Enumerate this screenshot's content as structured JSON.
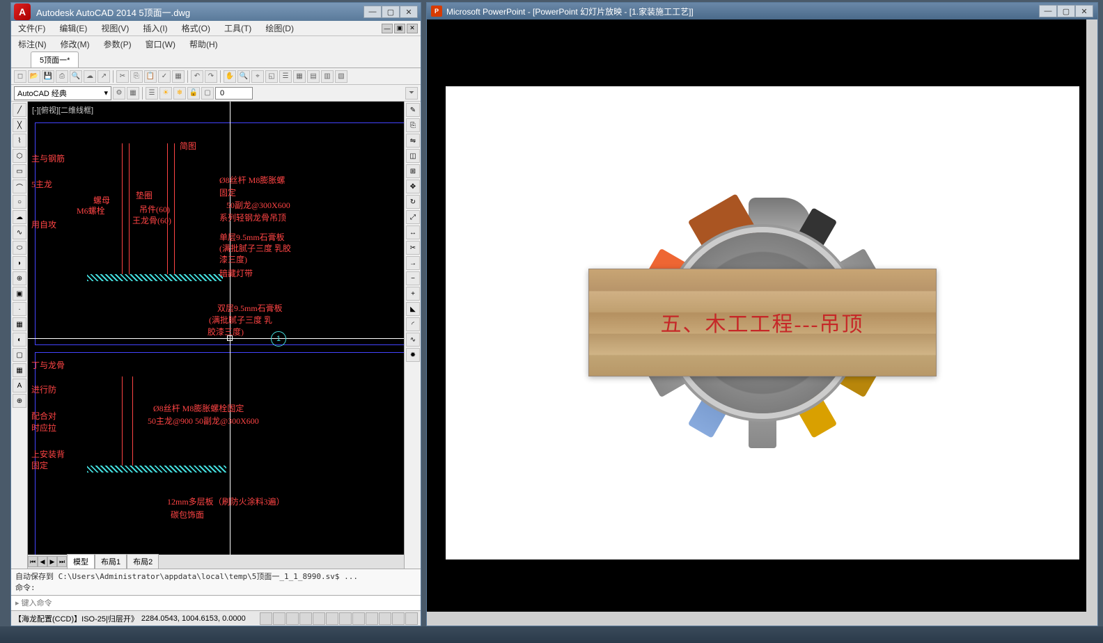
{
  "autocad": {
    "title": "Autodesk AutoCAD 2014    5顶面一.dwg",
    "logo": "A",
    "menu_row1": [
      "文件(F)",
      "编辑(E)",
      "视图(V)",
      "插入(I)",
      "格式(O)",
      "工具(T)",
      "绘图(D)"
    ],
    "menu_row2": [
      "标注(N)",
      "修改(M)",
      "参数(P)",
      "窗口(W)",
      "帮助(H)"
    ],
    "doc_tab": "5顶面一*",
    "workspace": "AutoCAD 经典",
    "layer_num": "0",
    "view_label": "[-][俯视][二维线框]",
    "layout_tabs": {
      "model": "模型",
      "l1": "布局1",
      "l2": "布局2"
    },
    "cmdline": {
      "history": "自动保存到 C:\\Users\\Administrator\\appdata\\local\\temp\\5顶面一_1_1_8990.sv$ ...",
      "prompt": "命令:",
      "placeholder": "键入命令"
    },
    "status": {
      "left": "【海龙配置(CCD)】ISO-25|归层开》",
      "coords": "2284.0543, 1004.6153, 0.0000"
    },
    "drawing_labels": {
      "t_简图": "简图",
      "t_主与钢筋": "主与钢筋",
      "t_5主龙": "5主龙",
      "t_用自攻": "用自攻",
      "t_螺母": "螺母",
      "t_M6螺栓": "M6螺栓",
      "t_垫圈": "垫圈",
      "t_吊件": "吊件(60)",
      "t_王龙骨": "王龙骨(60)",
      "t_杆": "Ø8丝杆 M8膨胀螺",
      "t_固定": "固定",
      "t_副龙": "50副龙@300X600",
      "t_轻钢": "系列轻钢龙骨吊顶",
      "t_单层": "单层9.5mm石膏板",
      "t_满批1": "(满批腻子三度 乳胶",
      "t_漆三度": "漆三度)",
      "t_暗藏灯带": "暗藏灯带",
      "t_双层": "双层9.5mm石膏板",
      "t_满批2": "(满批腻子三度 乳",
      "t_胶漆": "胶漆三度)",
      "t_圆1": "1",
      "t_丁与龙骨": "丁与龙骨",
      "t_进行防": "进行防",
      "t_配合对": "配合对",
      "t_时应拉": "时应拉",
      "t_安装背": "上安装背",
      "t_杆2": "Ø8丝杆 M8膨胀螺栓固定",
      "t_主龙2": "50主龙@900  50副龙@300X600",
      "t_轻钢2": "系列轻钢龙骨吊顶",
      "t_12mm": "12mm多层板（刷防火涂料3遍）",
      "t_碳包饰面": "碳包饰面"
    }
  },
  "powerpoint": {
    "title": "Microsoft PowerPoint - [PowerPoint 幻灯片放映 - [1.家装施工工艺]]",
    "icon": "P",
    "slide_title": "五、木工工程---吊顶"
  }
}
